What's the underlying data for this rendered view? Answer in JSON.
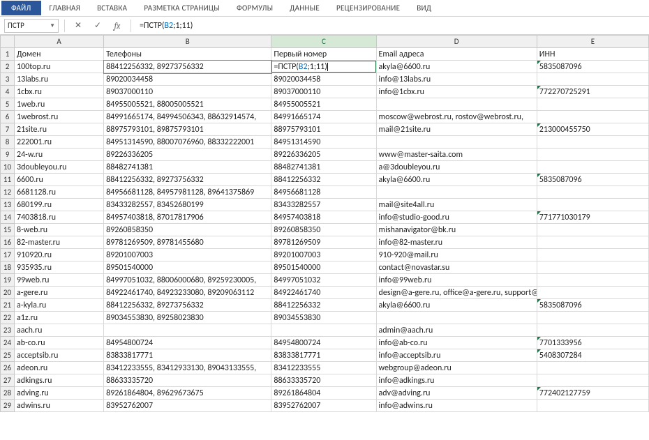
{
  "ribbon": {
    "file": "ФАЙЛ",
    "tabs": [
      "ГЛАВНАЯ",
      "ВСТАВКА",
      "РАЗМЕТКА СТРАНИЦЫ",
      "ФОРМУЛЫ",
      "ДАННЫЕ",
      "РЕЦЕНЗИРОВАНИЕ",
      "ВИД"
    ]
  },
  "namebox": "ПСТР",
  "fx_icons": {
    "cancel": "✕",
    "accept": "✓",
    "fx": "fx"
  },
  "formula_display": {
    "fn": "ПСТР",
    "ref": "B2",
    "tail": ";1;11)"
  },
  "formula_plain": "=ПСТР(B2;1;11)",
  "col_letters": [
    "A",
    "B",
    "C",
    "D",
    "E"
  ],
  "headers": {
    "A": "Домен",
    "B": "Телефоны",
    "C": "Первый номер",
    "D": "Email адреса",
    "E": "ИНН"
  },
  "active_edit": {
    "fn": "ПСТР",
    "ref": "B2",
    "tail": ";1;11)"
  },
  "rows": [
    {
      "n": 2,
      "A": "100top.ru",
      "B": "88412256332, 89273756332",
      "C": "__EDIT__",
      "D": "akyla@6600.ru",
      "E": "5835087096",
      "triE": true,
      "triD": false
    },
    {
      "n": 3,
      "A": "13labs.ru",
      "B": "89020034458",
      "C": "89020034458",
      "D": "info@13labs.ru",
      "E": ""
    },
    {
      "n": 4,
      "A": "1cbx.ru",
      "B": "89037000110",
      "C": "89037000110",
      "D": "info@1cbx.ru",
      "E": "772270725291",
      "triE": true
    },
    {
      "n": 5,
      "A": "1web.ru",
      "B": "84955005521, 88005005521",
      "C": "84955005521",
      "D": "",
      "E": ""
    },
    {
      "n": 6,
      "A": "1webrost.ru",
      "B": "84991665174, 84994506343, 88632914574,",
      "C": "84991665174",
      "D": "moscow@webrost.ru, rostov@webrost.ru,",
      "E": ""
    },
    {
      "n": 7,
      "A": "21site.ru",
      "B": "88975793101, 89875793101",
      "C": "88975793101",
      "D": "mail@21site.ru",
      "E": "213000455750",
      "triE": true
    },
    {
      "n": 8,
      "A": "222001.ru",
      "B": "84951314590, 88007076960, 88332222001",
      "C": "84951314590",
      "D": "",
      "E": ""
    },
    {
      "n": 9,
      "A": "24-w.ru",
      "B": "89226336205",
      "C": "89226336205",
      "D": "www@master-saita.com",
      "E": ""
    },
    {
      "n": 10,
      "A": "3doubleyou.ru",
      "B": "88482741381",
      "C": "88482741381",
      "D": "a@3doubleyou.ru",
      "E": ""
    },
    {
      "n": 11,
      "A": "6600.ru",
      "B": "88412256332, 89273756332",
      "C": "88412256332",
      "D": "akyla@6600.ru",
      "E": "5835087096",
      "triE": true
    },
    {
      "n": 12,
      "A": "6681128.ru",
      "B": "84956681128, 84957981128, 89641375869",
      "C": "84956681128",
      "D": "",
      "E": ""
    },
    {
      "n": 13,
      "A": "680199.ru",
      "B": "83433282557, 83452680199",
      "C": "83433282557",
      "D": "mail@site4all.ru",
      "E": ""
    },
    {
      "n": 14,
      "A": "7403818.ru",
      "B": "84957403818, 87017817906",
      "C": "84957403818",
      "D": "info@studio-good.ru",
      "E": "771771030179",
      "triE": true
    },
    {
      "n": 15,
      "A": "8-web.ru",
      "B": "89260858350",
      "C": "89260858350",
      "D": "mishanavigator@bk.ru",
      "E": ""
    },
    {
      "n": 16,
      "A": "82-master.ru",
      "B": "89781269509, 89781455680",
      "C": "89781269509",
      "D": "info@82-master.ru",
      "E": ""
    },
    {
      "n": 17,
      "A": "910920.ru",
      "B": "89201007003",
      "C": "89201007003",
      "D": "910-920@mail.ru",
      "E": ""
    },
    {
      "n": 18,
      "A": "935935.ru",
      "B": "89501540000",
      "C": "89501540000",
      "D": "contact@novastar.su",
      "E": ""
    },
    {
      "n": 19,
      "A": "99web.ru",
      "B": "84997051032, 88006000680, 89259230005,",
      "C": "84997051032",
      "D": "info@99web.ru",
      "E": ""
    },
    {
      "n": 20,
      "A": "a-gere.ru",
      "B": "84922461740, 84923233080, 89209063112",
      "C": "84922461740",
      "D": "design@a-gere.ru, office@a-gere.ru, support@a-gere.ru",
      "E": ""
    },
    {
      "n": 21,
      "A": "a-kyla.ru",
      "B": "88412256332, 89273756332",
      "C": "88412256332",
      "D": "akyla@6600.ru",
      "E": "5835087096",
      "triE": true
    },
    {
      "n": 22,
      "A": "a1z.ru",
      "B": "89034553830, 89258023830",
      "C": "89034553830",
      "D": "",
      "E": ""
    },
    {
      "n": 23,
      "A": "aach.ru",
      "B": "",
      "C": "",
      "D": "admin@aach.ru",
      "E": ""
    },
    {
      "n": 24,
      "A": "ab-co.ru",
      "B": "84954800724",
      "C": "84954800724",
      "D": "info@ab-co.ru",
      "E": "7701333956",
      "triE": true
    },
    {
      "n": 25,
      "A": "acceptsib.ru",
      "B": "83833817771",
      "C": "83833817771",
      "D": "info@acceptsib.ru",
      "E": "5408307284",
      "triE": true
    },
    {
      "n": 26,
      "A": "adeon.ru",
      "B": "83412233555, 83412933130, 89043133555,",
      "C": "83412233555",
      "D": "webgroup@adeon.ru",
      "E": ""
    },
    {
      "n": 27,
      "A": "adkings.ru",
      "B": "88633335720",
      "C": "88633335720",
      "D": "info@adkings.ru",
      "E": ""
    },
    {
      "n": 28,
      "A": "adving.ru",
      "B": "89261864804, 89629673675",
      "C": "89261864804",
      "D": "adv@adving.ru",
      "E": "772402127759",
      "triE": true
    },
    {
      "n": 29,
      "A": "adwins.ru",
      "B": "83952762007",
      "C": "83952762007",
      "D": "info@adwins.ru",
      "E": ""
    }
  ]
}
